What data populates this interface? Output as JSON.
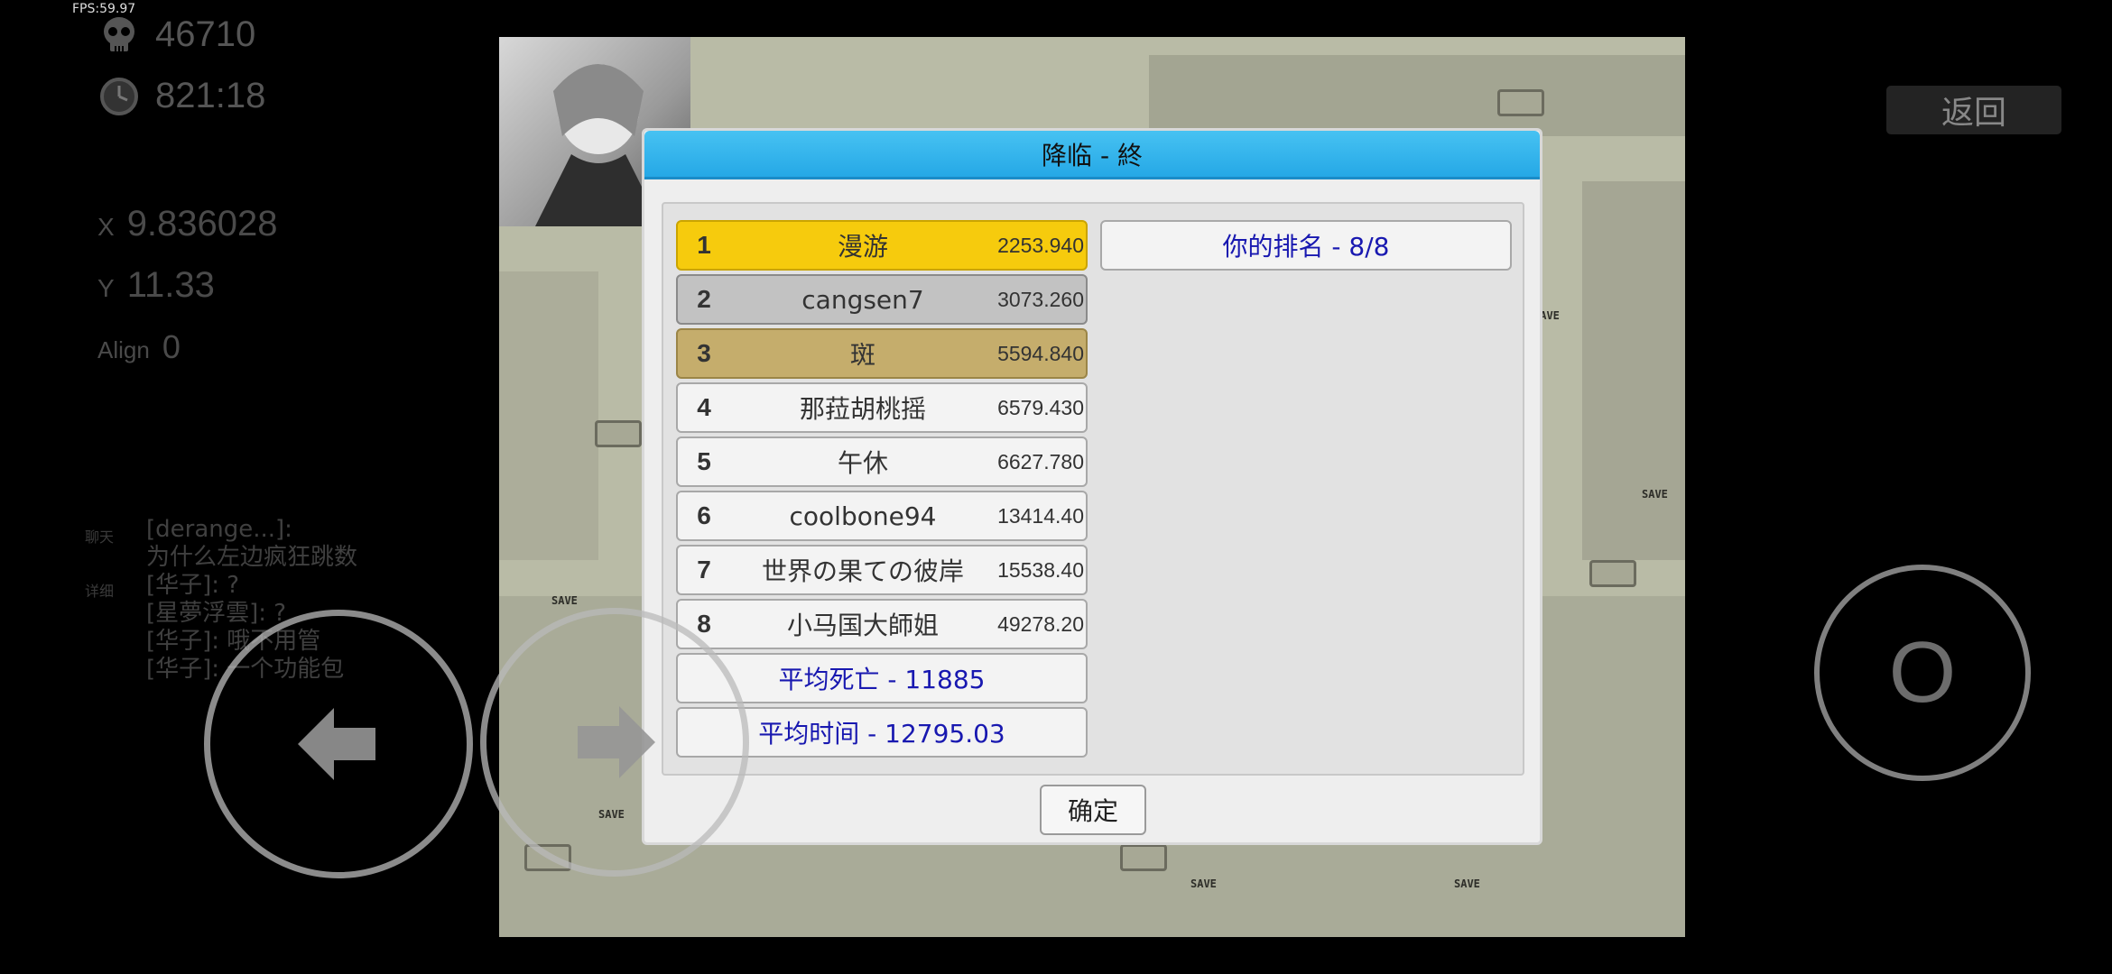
{
  "hud": {
    "fps": "FPS:59.97",
    "deaths": "46710",
    "time": "821:18",
    "x_label": "X",
    "x_value": "9.836028",
    "y_label": "Y",
    "y_value": "11.33",
    "align_label": "Align",
    "align_value": "0",
    "chat_tag": "聊天",
    "detail_tag": "详细"
  },
  "chat": {
    "lines": [
      "[derange...]:",
      "为什么左边疯狂跳数",
      "[华子]: ?",
      "[星夢浮雲]: ?",
      "[华子]: 哦不用管",
      "[华子]: 一个功能包"
    ]
  },
  "dialog": {
    "title": "降临 - 終",
    "leaderboard": [
      {
        "rank": "1",
        "name": "漫游",
        "score": "2253.940"
      },
      {
        "rank": "2",
        "name": "cangsen7",
        "score": "3073.260"
      },
      {
        "rank": "3",
        "name": "斑",
        "score": "5594.840"
      },
      {
        "rank": "4",
        "name": "那菈胡桃摇",
        "score": "6579.430"
      },
      {
        "rank": "5",
        "name": "午休",
        "score": "6627.780"
      },
      {
        "rank": "6",
        "name": "coolbone94",
        "score": "13414.40"
      },
      {
        "rank": "7",
        "name": "世界の果ての彼岸",
        "score": "15538.40"
      },
      {
        "rank": "8",
        "name": "小马国大師姐",
        "score": "49278.20"
      }
    ],
    "avg_deaths": "平均死亡 - 11885",
    "avg_time": "平均时间 - 12795.03",
    "your_rank": "你的排名 - 8/8",
    "confirm_label": "确定"
  },
  "controls": {
    "back_label": "返回",
    "jump_label": "O",
    "left_icon": "arrow-left-icon",
    "right_icon": "arrow-right-icon"
  },
  "colors": {
    "title_bar": "#2aaeea",
    "gold": "#f6cb0d",
    "silver": "#c2c2c2",
    "bronze": "#c5ad6c",
    "summary_text": "#1818b0"
  }
}
